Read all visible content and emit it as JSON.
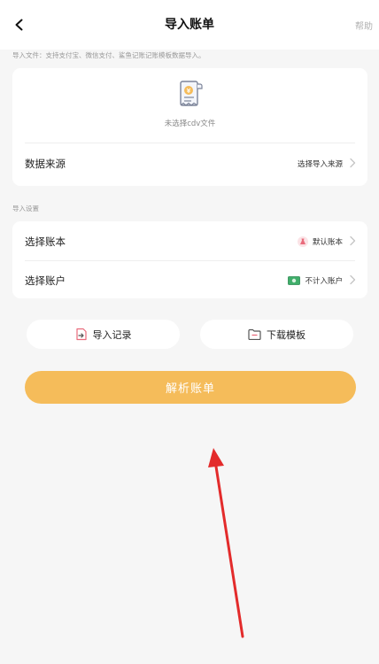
{
  "header": {
    "title": "导入账单",
    "help_label": "帮助"
  },
  "import_hint": "导入文件：支持支付宝、微信支付、鲨鱼记账记账模板数据导入。",
  "file_card": {
    "empty_text": "未选择cdv文件",
    "source_label": "数据来源",
    "source_value": "选择导入来源"
  },
  "settings_hint": "导入设置",
  "settings": {
    "ledger_label": "选择账本",
    "ledger_value": "默认账本",
    "account_label": "选择账户",
    "account_value": "不计入账户"
  },
  "actions": {
    "history_label": "导入记录",
    "template_label": "下载模板",
    "parse_label": "解析账单"
  },
  "colors": {
    "accent": "#f5bc5a",
    "annotation_arrow": "#e32b2b"
  }
}
